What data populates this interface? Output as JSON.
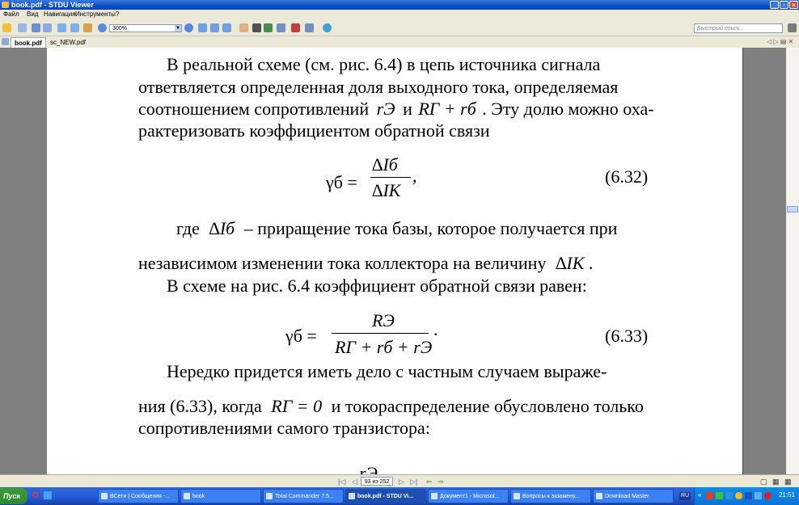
{
  "window": {
    "title": "book.pdf - STDU Viewer"
  },
  "menu": [
    "Файл",
    "Вид",
    "Навигация",
    "Инструменты",
    "?"
  ],
  "toolbar": {
    "zoom": "300%",
    "search_placeholder": "Быстрый поиск..."
  },
  "tabs": [
    {
      "label": "book.pdf",
      "active": true
    },
    {
      "label": "sc_NEW.pdf",
      "active": false
    }
  ],
  "document": {
    "lines": [
      "В реальной схеме (см. рис. 6.4) в цепь источника сигнала",
      "ответвляется определенная доля выходного тока, определяемая",
      "соотношением сопротивлений",
      "и",
      ". Эту долю можно оха-",
      "рактеризовать коэффициентом обратной связи",
      "где",
      "– приращение тока базы, которое получается при",
      "независимом изменении тока коллектора на величину",
      "В схеме на рис. 6.4 коэффициент обратной связи равен:",
      "Нередко придется иметь дело с частным случаем выраже-",
      "ния (6.33), когда",
      "и токораспределение обусловлено только",
      "сопротивлениями самого транзистора:"
    ],
    "eq1_number": "(6.32)",
    "eq2_number": "(6.33)",
    "r_e": "rЭ",
    "R_g_sum": "RГ + rб",
    "delta_Ib": "∆Iб",
    "delta_Ik": "∆IK",
    "gamma_b": "γб =",
    "frac1_num": "∆Iб",
    "frac1_den": "∆IK",
    "frac2_num": "RЭ",
    "frac2_den": "RГ + rб + rЭ",
    "R_g_zero": "RГ = 0",
    "bottom_partial": "rЭ"
  },
  "navbar": {
    "page": "93 из 252"
  },
  "taskbar": {
    "start": "Пуск",
    "tasks": [
      {
        "label": "ВСети | Сообщения -...",
        "active": false
      },
      {
        "label": "book",
        "active": false
      },
      {
        "label": "Total Commander 7.5...",
        "active": false
      },
      {
        "label": "book.pdf - STDU Vi...",
        "active": true
      },
      {
        "label": "Документ1 - Microsof...",
        "active": false
      },
      {
        "label": "Вопросы к экзамену...",
        "active": false
      },
      {
        "label": "Download Master",
        "active": false
      }
    ],
    "lang": "RU",
    "clock": "21:51"
  }
}
